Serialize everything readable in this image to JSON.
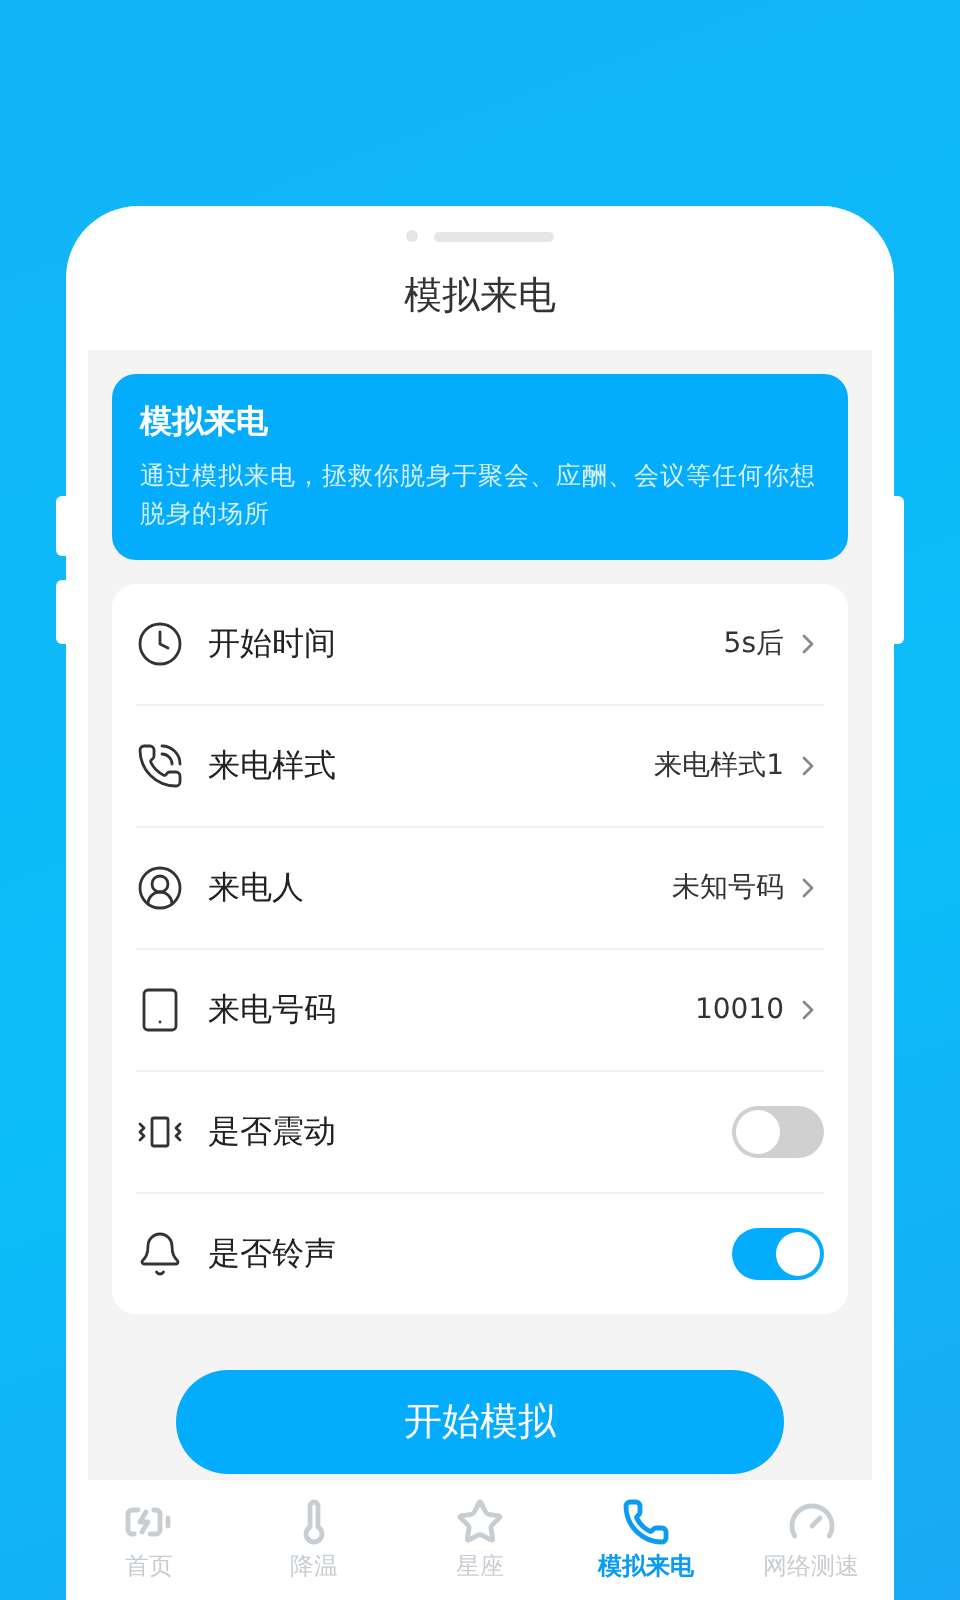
{
  "header": {
    "title": "模拟来电"
  },
  "banner": {
    "title": "模拟来电",
    "description": "通过模拟来电，拯救你脱身于聚会、应酬、会议等任何你想脱身的场所"
  },
  "settings": [
    {
      "kind": "value",
      "label": "开始时间",
      "value": "5s后"
    },
    {
      "kind": "value",
      "label": "来电样式",
      "value": "来电样式1"
    },
    {
      "kind": "value",
      "label": "来电人",
      "value": "未知号码"
    },
    {
      "kind": "value",
      "label": "来电号码",
      "value": "10010"
    },
    {
      "kind": "switch",
      "label": "是否震动",
      "on": false
    },
    {
      "kind": "switch",
      "label": "是否铃声",
      "on": true
    }
  ],
  "start_button": "开始模拟",
  "tab_bar": [
    {
      "label": "首页",
      "selected": false
    },
    {
      "label": "降温",
      "selected": false
    },
    {
      "label": "星座",
      "selected": false
    },
    {
      "label": "模拟来电",
      "selected": true
    },
    {
      "label": "网络测速",
      "selected": false
    }
  ]
}
